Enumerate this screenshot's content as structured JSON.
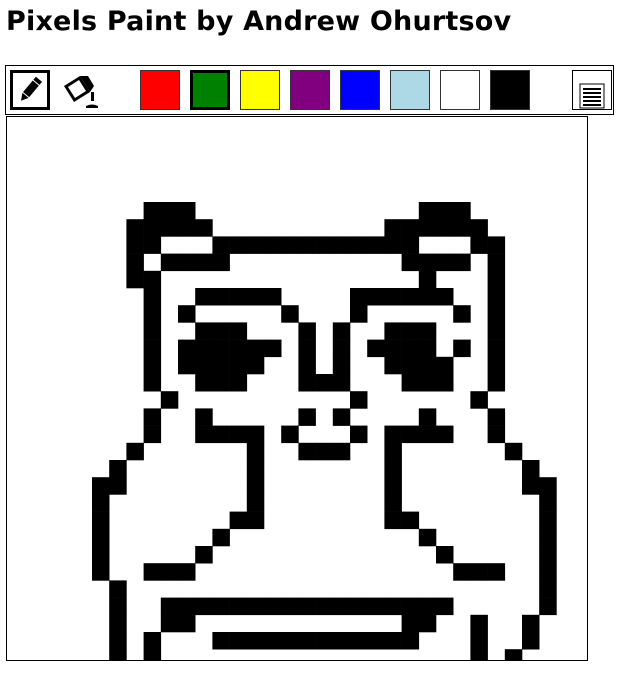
{
  "page": {
    "title": "Pixels Paint by Andrew Ohurtsov"
  },
  "toolbar": {
    "tools": [
      {
        "name": "pencil",
        "icon": "pencil-icon",
        "selected": true
      },
      {
        "name": "fill",
        "icon": "paint-bucket-icon",
        "selected": false
      }
    ],
    "palette": [
      {
        "name": "red",
        "hex": "#ff0000",
        "selected": false
      },
      {
        "name": "green",
        "hex": "#008000",
        "selected": true
      },
      {
        "name": "yellow",
        "hex": "#ffff00",
        "selected": false
      },
      {
        "name": "purple",
        "hex": "#800080",
        "selected": false
      },
      {
        "name": "blue",
        "hex": "#0000ff",
        "selected": false
      },
      {
        "name": "lightblue",
        "hex": "#add8e6",
        "selected": false
      },
      {
        "name": "white",
        "hex": "#ffffff",
        "selected": false
      },
      {
        "name": "black",
        "hex": "#000000",
        "selected": false
      }
    ],
    "menu_icon": "menu-lines-icon"
  },
  "canvas": {
    "background": "#ffffff",
    "drawing_color": "#000000",
    "drawing": "owl"
  }
}
